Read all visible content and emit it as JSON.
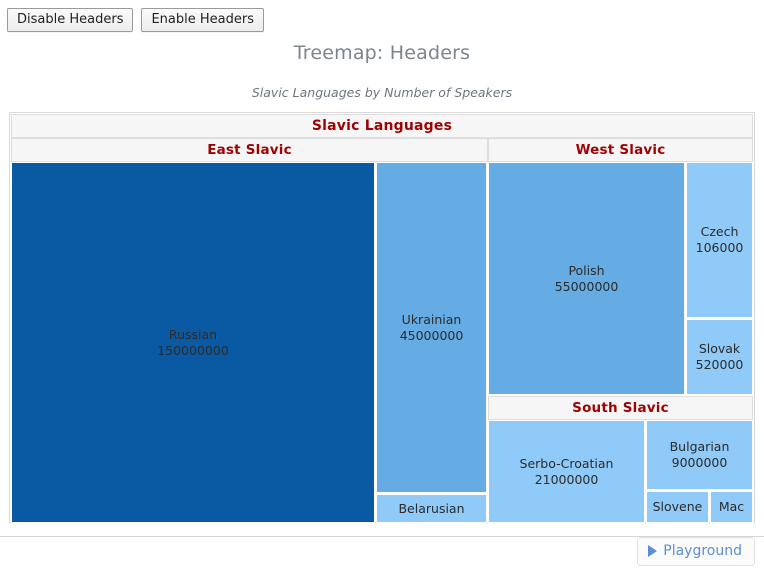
{
  "toolbar": {
    "disable_headers_label": "Disable Headers",
    "enable_headers_label": "Enable Headers"
  },
  "footer": {
    "playground_label": "Playground",
    "play_icon": "play-triangle-icon"
  },
  "colors": {
    "header_text": "#9e0202",
    "header_bg": "#f6f6f6",
    "depth1": "#0a5aa3",
    "depth2": "#66ace4",
    "depth3": "#8fcaf9",
    "accent": "#5b8fd4"
  },
  "chart_data": {
    "type": "treemap",
    "title": "Treemap: Headers",
    "subtitle": "Slavic Languages by Number of Speakers",
    "root_label": "Slavic Languages",
    "value_unit": "speakers",
    "groups": [
      {
        "label": "East Slavic",
        "children": [
          {
            "label": "Russian",
            "value": "150000000",
            "color": "#0a5aa3"
          },
          {
            "label": "Ukrainian",
            "value": "45000000",
            "color": "#66ace4"
          },
          {
            "label": "Belarusian",
            "value": "",
            "color": "#8fcaf9"
          }
        ]
      },
      {
        "label": "West Slavic",
        "children": [
          {
            "label": "Polish",
            "value": "55000000",
            "color": "#66ace4"
          },
          {
            "label": "Czech",
            "value": "106000",
            "color": "#8fcaf9"
          },
          {
            "label": "Slovak",
            "value": "520000",
            "color": "#8fcaf9"
          }
        ]
      },
      {
        "label": "South Slavic",
        "children": [
          {
            "label": "Serbo-Croatian",
            "value": "21000000",
            "color": "#8fcaf9"
          },
          {
            "label": "Bulgarian",
            "value": "9000000",
            "color": "#8fcaf9"
          },
          {
            "label": "Slovene",
            "value": "",
            "color": "#8fcaf9"
          },
          {
            "label": "Mac",
            "value": "",
            "color": "#8fcaf9"
          }
        ]
      }
    ]
  }
}
